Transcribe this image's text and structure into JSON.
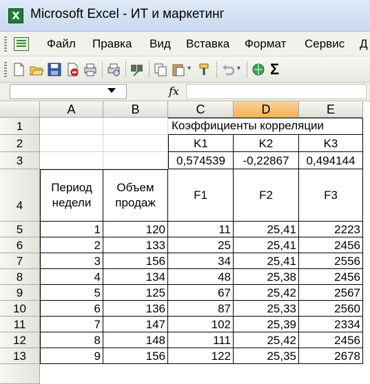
{
  "window": {
    "title": "Microsoft Excel - ИТ и маркетинг",
    "app_icon_letter": "X"
  },
  "menu": [
    {
      "label": "Файл"
    },
    {
      "label": "Правка"
    },
    {
      "label": "Вид"
    },
    {
      "label": "Вставка"
    },
    {
      "label": "Формат"
    },
    {
      "label": "Сервис"
    },
    {
      "label": "Д"
    }
  ],
  "toolbar": {
    "icons": [
      "new-icon",
      "open-icon",
      "save-icon",
      "permission-icon",
      "print-icon",
      "print-preview-icon",
      "spelling-icon",
      "copy-icon",
      "paste-icon",
      "format-painter-icon",
      "undo-icon",
      "hyperlink-icon"
    ],
    "autosum_glyph": "Σ"
  },
  "formula_bar": {
    "name_box_value": "",
    "fx_label": "fx",
    "formula_value": ""
  },
  "sheet": {
    "columns": [
      "A",
      "B",
      "C",
      "D",
      "E"
    ],
    "selected_column": "D",
    "row_numbers": [
      "1",
      "2",
      "3",
      "4",
      "5",
      "6",
      "7",
      "8",
      "9",
      "10",
      "11",
      "12",
      "13"
    ],
    "row1_title": "Коэффициенты корреляции",
    "row2": [
      "K1",
      "K2",
      "K3"
    ],
    "row3": [
      "0,574539",
      "-0,22867",
      "0,494144"
    ],
    "row4": [
      "Период недели",
      "Объем продаж",
      "F1",
      "F2",
      "F3"
    ],
    "data_rows": [
      [
        "1",
        "120",
        "11",
        "25,41",
        "2223"
      ],
      [
        "2",
        "133",
        "25",
        "25,41",
        "2456"
      ],
      [
        "3",
        "156",
        "34",
        "25,41",
        "2556"
      ],
      [
        "4",
        "134",
        "48",
        "25,38",
        "2456"
      ],
      [
        "5",
        "125",
        "67",
        "25,42",
        "2567"
      ],
      [
        "6",
        "136",
        "87",
        "25,33",
        "2560"
      ],
      [
        "7",
        "147",
        "102",
        "25,39",
        "2334"
      ],
      [
        "8",
        "148",
        "111",
        "25,42",
        "2456"
      ],
      [
        "9",
        "156",
        "122",
        "25,35",
        "2678"
      ]
    ]
  }
}
